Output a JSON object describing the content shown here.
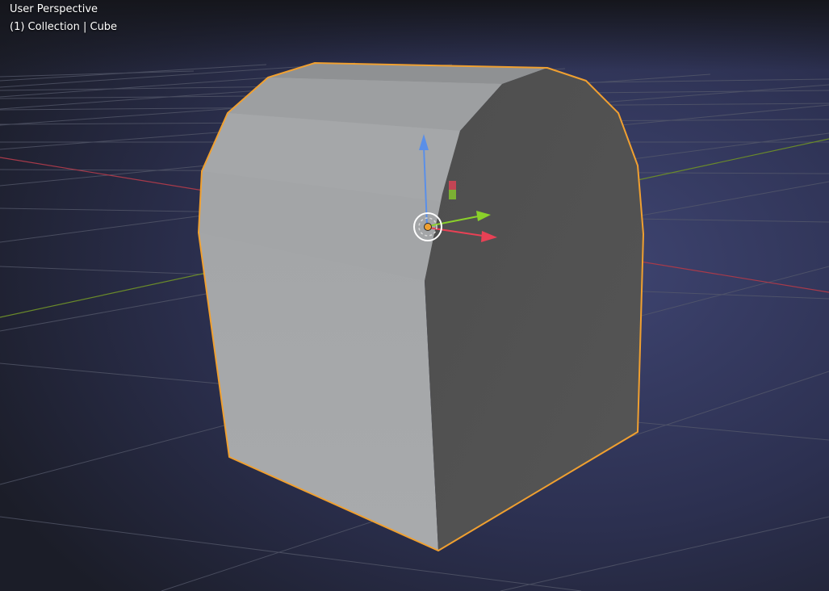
{
  "viewport": {
    "view_name": "User Perspective",
    "collection_info": "(1) Collection | Cube"
  },
  "scene": {
    "object_name": "Cube",
    "selected": true
  },
  "colors": {
    "background_center": "#3e4470",
    "background_edge": "#1a1c26",
    "grid_line": "#5a5e70",
    "x_axis": "#a83a4a",
    "y_axis": "#6a8a2a",
    "selection_outline": "#f0a030",
    "face_light": "#a7a9ab",
    "face_mid": "#9a9c9e",
    "face_dark": "#505050",
    "gizmo_x": "#e84155",
    "gizmo_y": "#8ad02a",
    "gizmo_z": "#5a8fe8",
    "origin_point": "#f0a030"
  },
  "icons": {
    "origin": "origin-point-icon",
    "pivot": "pivot-circle-icon"
  }
}
